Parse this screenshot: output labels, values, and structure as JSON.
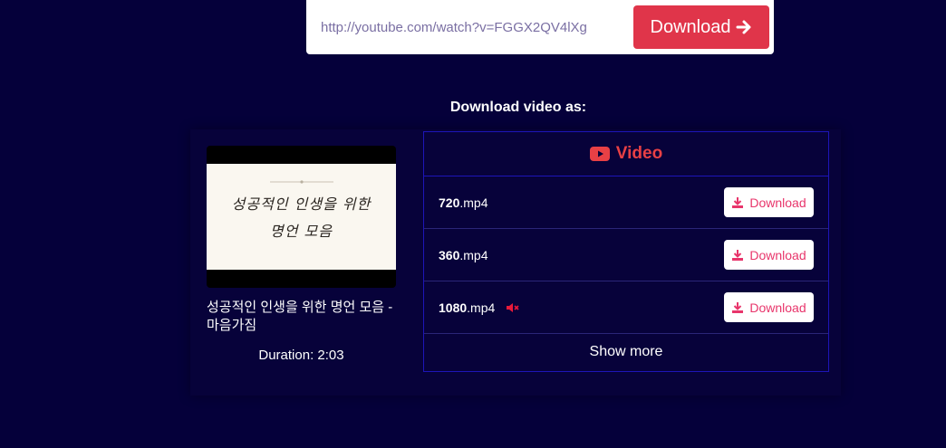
{
  "search": {
    "url_value": "http://youtube.com/watch?v=FGGX2QV4lXg",
    "download_label": "Download",
    "download_icon": "arrow-right-icon"
  },
  "heading": "Download video as:",
  "video": {
    "thumbnail_text_line1": "성공적인 인생을 위한",
    "thumbnail_text_line2": "명언 모음",
    "title": "성공적인 인생을 위한 명언 모음 - 마음가짐",
    "duration": "Duration: 2:03"
  },
  "table": {
    "header_label": "Video",
    "header_icon": "youtube-icon",
    "rows": [
      {
        "quality": "720",
        "ext": ".mp4",
        "muted": false,
        "button_label": "Download"
      },
      {
        "quality": "360",
        "ext": ".mp4",
        "muted": false,
        "button_label": "Download"
      },
      {
        "quality": "1080",
        "ext": ".mp4",
        "muted": true,
        "button_label": "Download"
      }
    ],
    "show_more": "Show more"
  },
  "colors": {
    "background": "#05003a",
    "accent_red": "#e0354a",
    "table_border": "#1d15b8",
    "button_text": "#e8356b"
  }
}
